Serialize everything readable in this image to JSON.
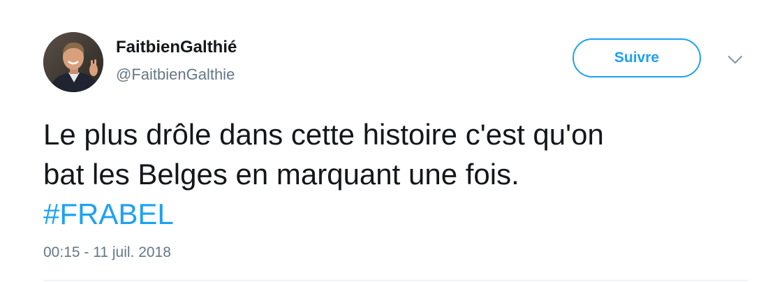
{
  "tweet": {
    "author": {
      "display_name": "FaitbienGalthié",
      "handle": "@FaitbienGalthie"
    },
    "follow_button": {
      "label": "Suivre"
    },
    "menu_icon": "chevron-down-icon",
    "text": {
      "line_1": "Le plus drôle dans cette histoire c'est qu'on",
      "line_2": "bat les Belges en marquant une fois.",
      "hashtag": "#FRABEL"
    },
    "timestamp": "00:15 - 11 juil. 2018"
  },
  "colors": {
    "accent": "#1da1f2",
    "text_primary": "#14171a",
    "text_secondary": "#657786",
    "divider": "#e6ecf0"
  }
}
